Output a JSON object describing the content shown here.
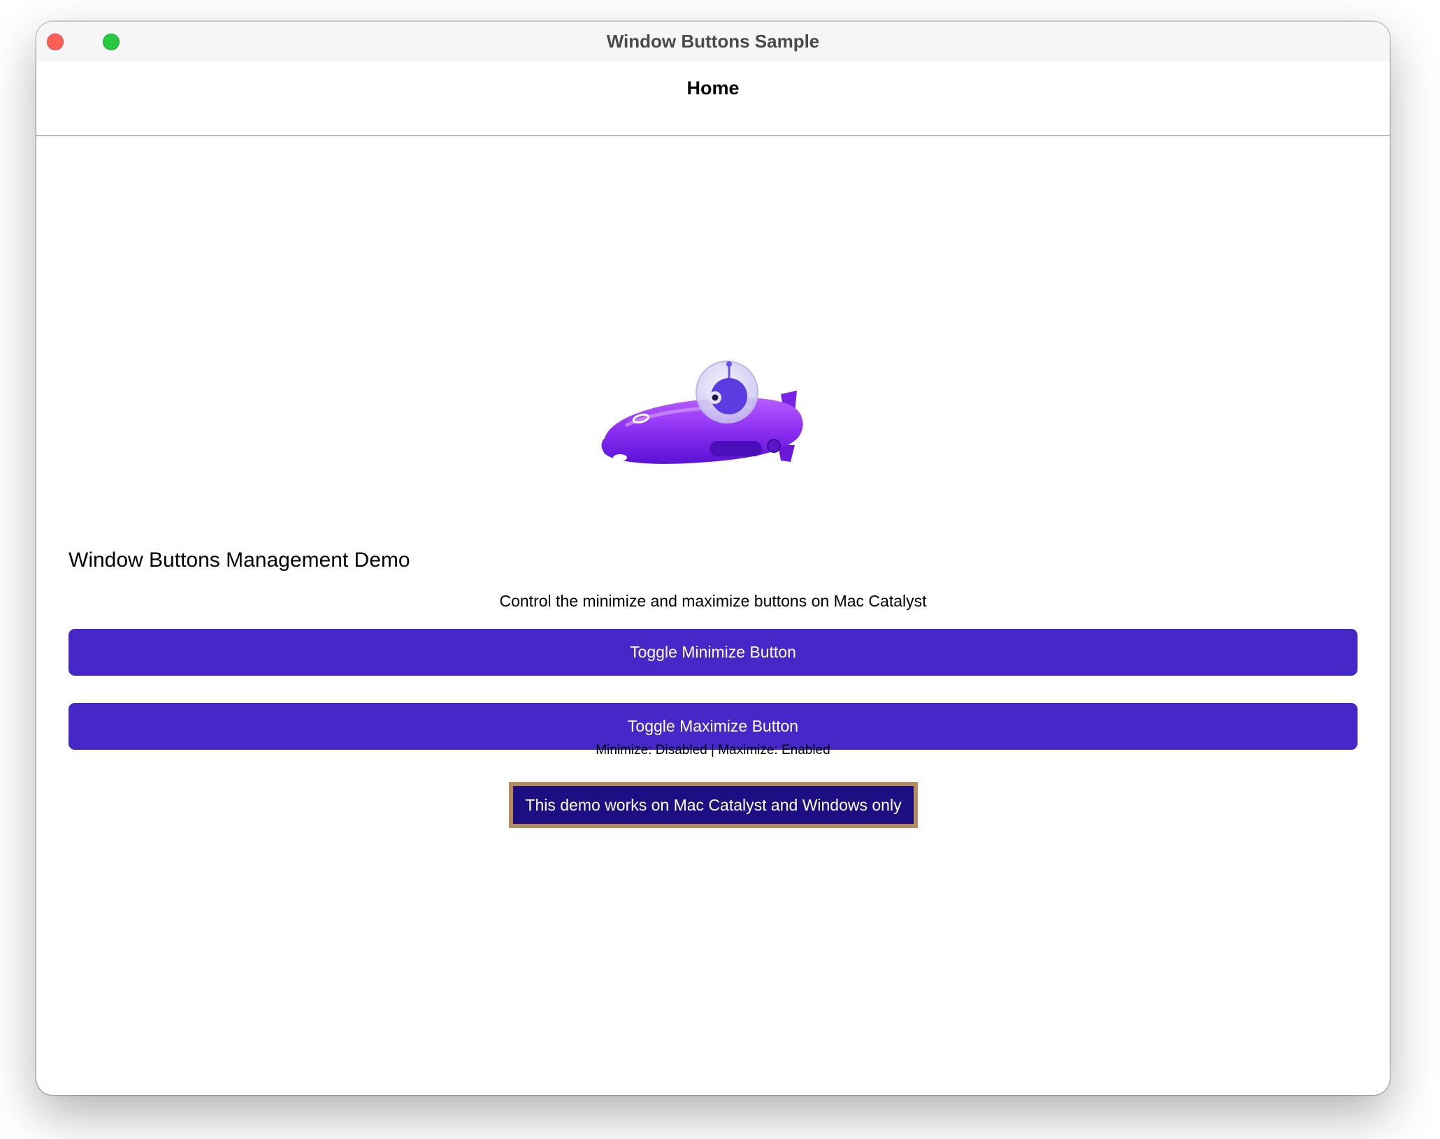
{
  "window": {
    "title": "Window Buttons Sample",
    "controls": [
      "close-icon",
      "zoom-icon"
    ]
  },
  "nav": {
    "title": "Home"
  },
  "hero": {
    "icon": "submarine-mascot"
  },
  "main": {
    "heading": "Window Buttons Management Demo",
    "description": "Control the minimize and maximize buttons on Mac Catalyst",
    "toggle_minimize_label": "Toggle Minimize Button",
    "toggle_maximize_label": "Toggle Maximize Button",
    "status_text": "Minimize: Disabled | Maximize: Enabled",
    "notice_text": "This demo works on Mac Catalyst and Windows only"
  },
  "colors": {
    "button": "#4727c8",
    "notice_bg": "#1d0e82",
    "notice_border": "#b38b5f",
    "close": "#fe5f57",
    "zoom": "#28c840"
  }
}
